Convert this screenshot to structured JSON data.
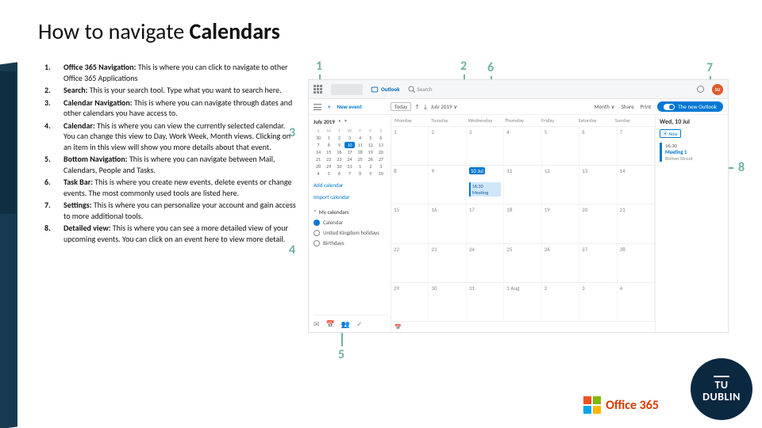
{
  "title": {
    "pre": "How to navigate ",
    "bold": "Calendars"
  },
  "items": [
    {
      "n": "1.",
      "lead": "Office 365 Navigation: ",
      "rest": "This is where you can click to navigate to other Office 365 Applications"
    },
    {
      "n": "2.",
      "lead": "Search: ",
      "rest": "This is your search tool. Type what you want to search here."
    },
    {
      "n": "3.",
      "lead": "Calendar Navigation: ",
      "rest": "This is where you can navigate through dates and other calendars you have access to."
    },
    {
      "n": "4.",
      "lead": "Calendar: ",
      "rest": "This is where you can view the currently selected calendar. You can change this view to Day, Work Week, Month views. Clicking on an item in this view will show you more details about that event."
    },
    {
      "n": "5.",
      "lead": "Bottom Navigation: ",
      "rest": "This is where you can navigate between Mail, Calendars, People and Tasks."
    },
    {
      "n": "6.",
      "lead": "Task Bar: ",
      "rest": "This is where you create new events, delete events or change events. The most commonly used tools are listed here."
    },
    {
      "n": "7.",
      "lead": "Settings: ",
      "rest": "This is where you can personalize your account and gain access to more additional tools."
    },
    {
      "n": "8.",
      "lead": "Detailed view: ",
      "rest": "This is where you can see a more detailed view of your upcoming events. You can click on an event here to view more detail."
    }
  ],
  "callouts": {
    "c1": "1",
    "c2": "2",
    "c3": "3",
    "c4": "4",
    "c5": "5",
    "c6": "6",
    "c7": "7",
    "c8": "8"
  },
  "shot": {
    "top": {
      "outlook": "Outlook",
      "search": "Search",
      "avatar": "SU"
    },
    "toolbar": {
      "plus": "+",
      "new": "New event",
      "today": "Today",
      "up": "↑",
      "down": "↓",
      "month_sel": "July 2019 ∨",
      "view": "Month ∨",
      "share": "Share",
      "print": "Print",
      "pill": "The new Outlook"
    },
    "side": {
      "month": "July 2019",
      "dow": [
        "S",
        "M",
        "T",
        "W",
        "T",
        "F",
        "S"
      ],
      "days": [
        "30",
        "1",
        "2",
        "3",
        "4",
        "5",
        "6",
        "7",
        "8",
        "9",
        "10",
        "11",
        "12",
        "13",
        "14",
        "15",
        "16",
        "17",
        "18",
        "19",
        "20",
        "21",
        "22",
        "23",
        "24",
        "25",
        "26",
        "27",
        "28",
        "29",
        "30",
        "31",
        "1",
        "2",
        "3",
        "4",
        "5",
        "6",
        "7",
        "8",
        "9",
        "10"
      ],
      "selected_index": 10,
      "add": "Add calendar",
      "import": "Import calendar",
      "section": "My calendars",
      "cals": [
        "Calendar",
        "United Kingdom holidays",
        "Birthdays"
      ],
      "bottom_icons": [
        "✉",
        "📅",
        "👥",
        "✓"
      ]
    },
    "grid": {
      "dow": [
        "Monday",
        "Tuesday",
        "Wednesday",
        "Thursday",
        "Friday",
        "Saturday",
        "Sunday"
      ],
      "weeks": [
        [
          "1",
          "2",
          "3",
          "4",
          "5",
          "6",
          "7"
        ],
        [
          "8",
          "9",
          "10 Jul",
          "11",
          "12",
          "13",
          "14"
        ],
        [
          "15",
          "16",
          "17",
          "18",
          "19",
          "20",
          "21"
        ],
        [
          "22",
          "23",
          "24",
          "25",
          "26",
          "27",
          "28"
        ],
        [
          "29",
          "30",
          "31",
          "1 Aug",
          "2",
          "3",
          "4"
        ]
      ],
      "today_week": 1,
      "today_col": 2,
      "event_week": 1,
      "event_col": 2,
      "event_label": "16:30 Meeting",
      "foot": "📅"
    },
    "detail": {
      "header": "Wed, 10 Jul",
      "now": "⦿ Now",
      "time": "16:30",
      "title": "Meeting 1",
      "room": "Bolton Street"
    }
  },
  "footer": {
    "office": "Office 365",
    "tud_lines": [
      "TU",
      "DUBLIN"
    ]
  }
}
